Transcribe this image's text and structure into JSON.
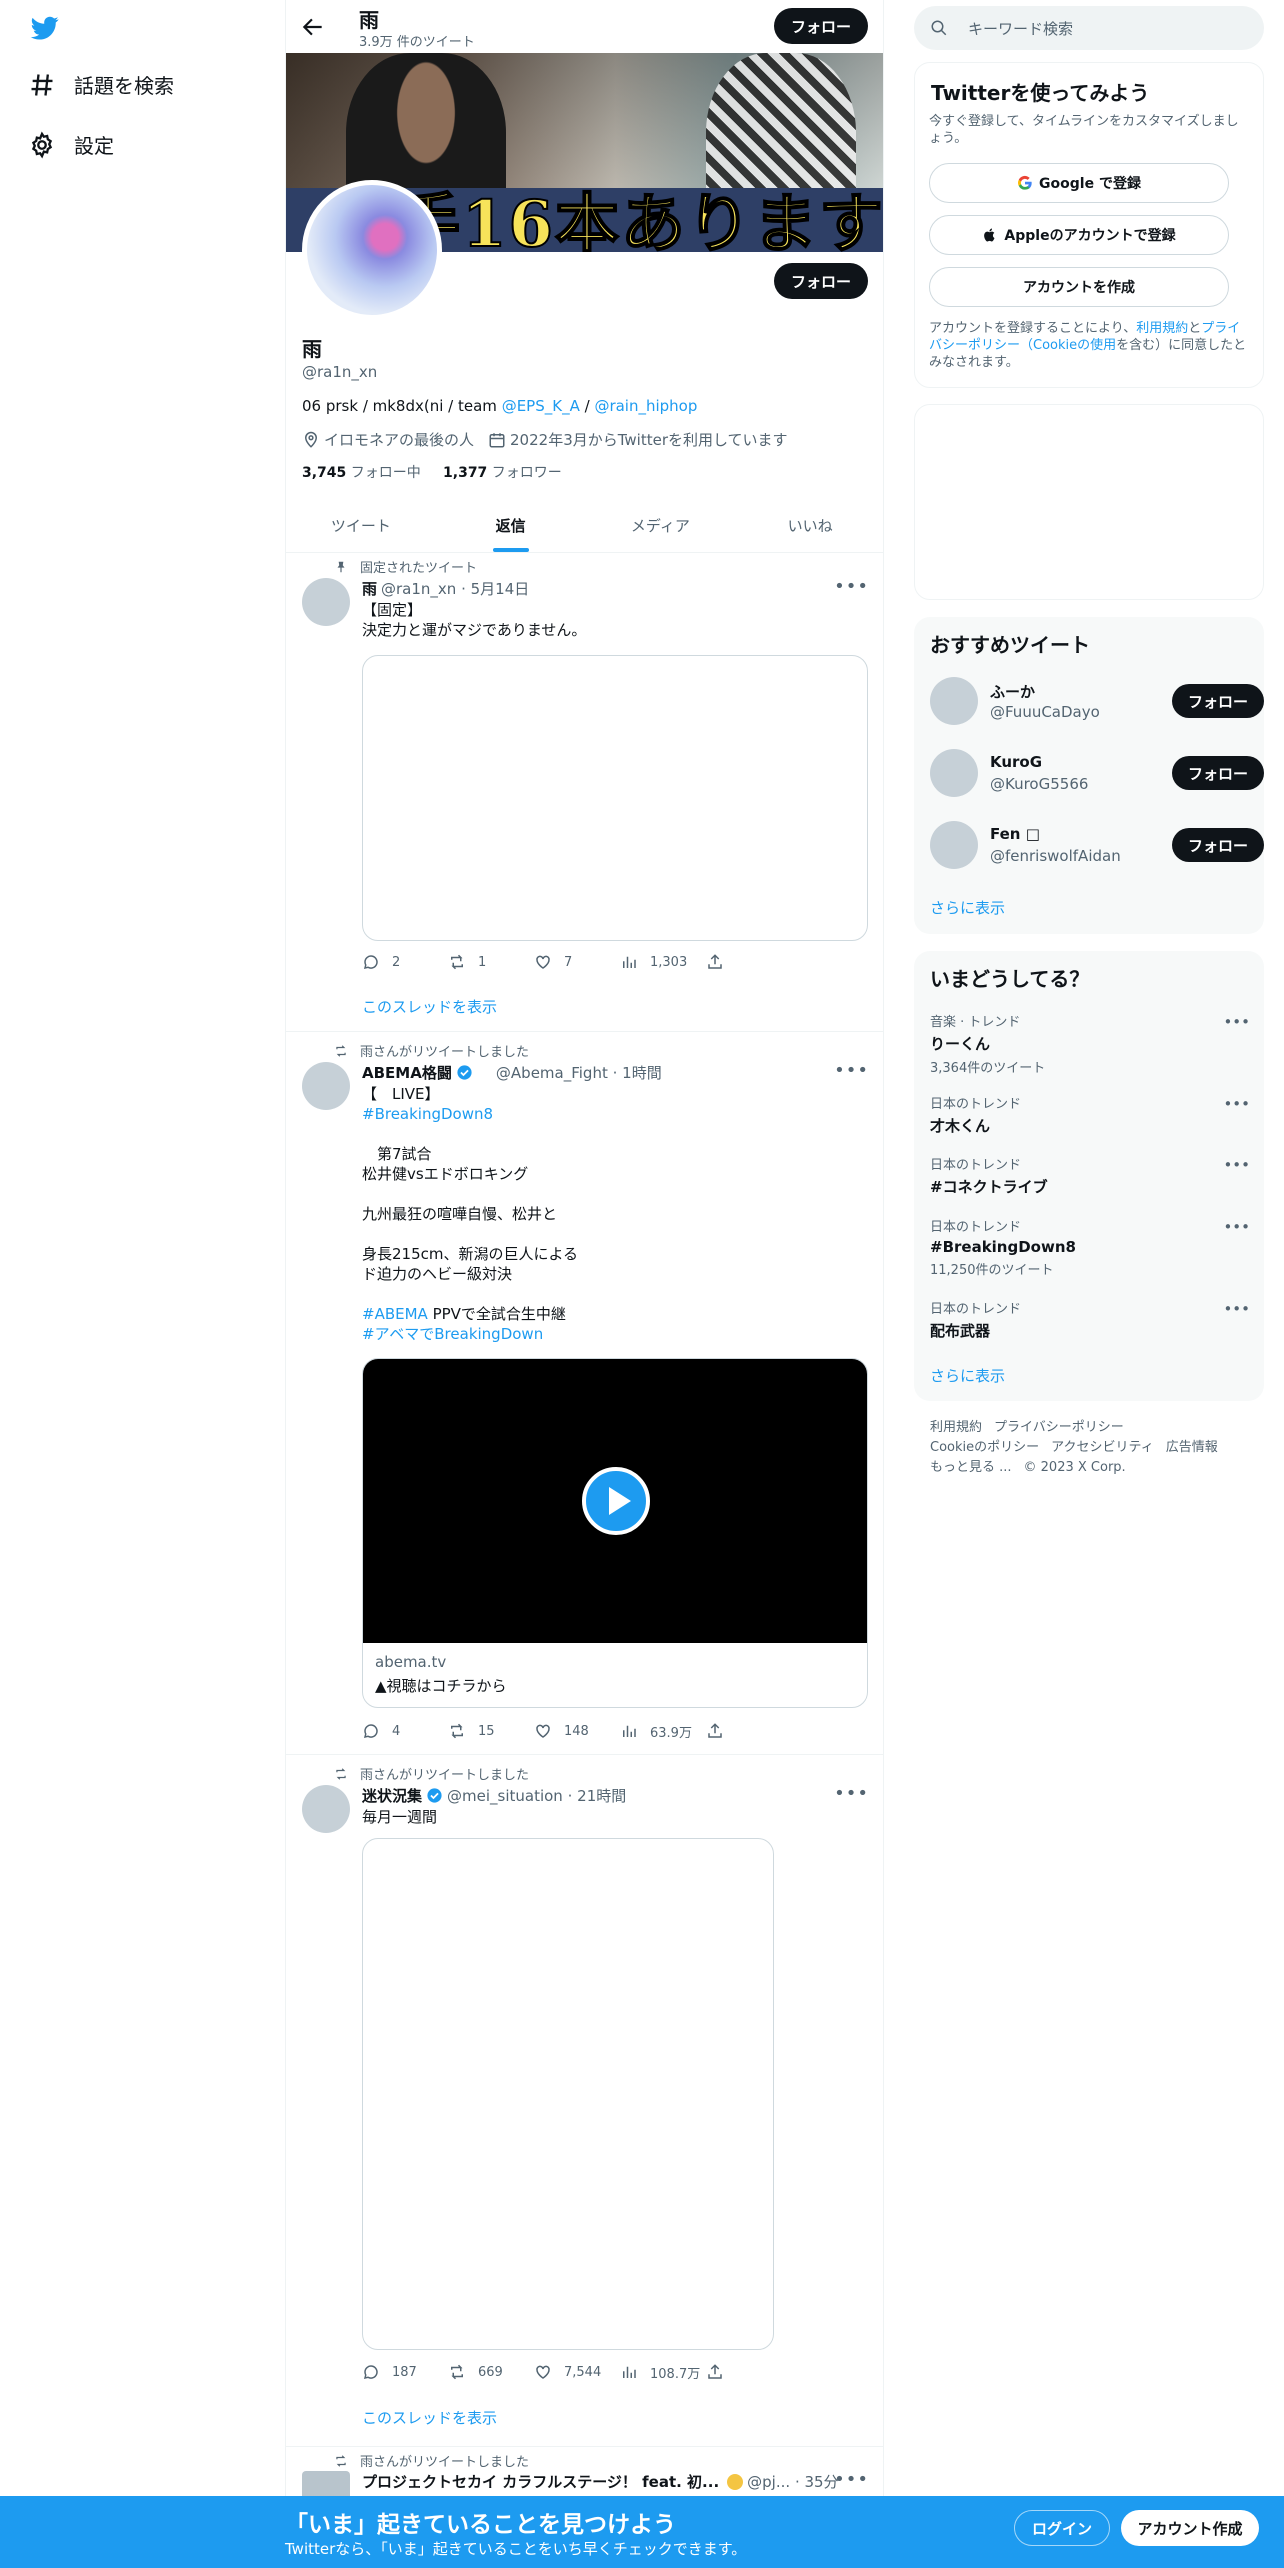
{
  "nav": {
    "logo": "twitter-bird",
    "items": [
      {
        "label": "話題を検索",
        "icon": "hashtag-icon"
      },
      {
        "label": "設定",
        "icon": "gear-icon"
      }
    ]
  },
  "header": {
    "name": "雨",
    "tweet_count": "3.9万 件のツイート",
    "follow_label": "フォロー"
  },
  "banner": {
    "caption": "手16本あります"
  },
  "profile": {
    "name": "雨",
    "handle": "@ra1n_xn",
    "bio_prefix": "06 prsk / mk8dx(ni / team ",
    "bio_link1": "@EPS_K_A",
    "bio_sep": " / ",
    "bio_link2": "@rain_hiphop",
    "location": "イロモネアの最後の人",
    "joined": "2022年3月からTwitterを利用しています",
    "following_count": "3,745",
    "following_label": "フォロー中",
    "followers_count": "1,377",
    "followers_label": "フォロワー",
    "follow_label": "フォロー"
  },
  "tabs": [
    {
      "label": "ツイート",
      "active": false
    },
    {
      "label": "返信",
      "active": true
    },
    {
      "label": "メディア",
      "active": false
    },
    {
      "label": "いいね",
      "active": false
    }
  ],
  "tweets": [
    {
      "context": "固定されたツイート",
      "name": "雨",
      "handle": "@ra1n_xn",
      "time": "· 5月14日",
      "text": "【固定】\n決定力と運がマジでありません。",
      "replies": "2",
      "retweets": "1",
      "likes": "7",
      "views": "1,303",
      "thread": "このスレッドを表示"
    },
    {
      "context": "雨さんがリツイートしました",
      "name": "ABEMA格闘",
      "handle": "@Abema_Fight",
      "time": "· 1時間",
      "text_line1": "【　LIVE】",
      "hashtag1": "#BreakingDown8",
      "text_body": "\n　第7試合\n松井健vsエドボロキング\n\n九州最狂の喧嘩自慢、松井と\n\n身長215cm、新潟の巨人による\nド迫力のヘビー級対決\n",
      "hashtag2": "#ABEMA",
      "text_after_hashtag2": " PPVで全試合生中継",
      "hashtag3": "#アベマでBreakingDown",
      "card_domain": "abema.tv",
      "card_title": "▲視聴はコチラから",
      "replies": "4",
      "retweets": "15",
      "likes": "148",
      "views": "63.9万"
    },
    {
      "context": "雨さんがリツイートしました",
      "name": "迷状況集",
      "handle": "@mei_situation",
      "time": "· 21時間",
      "text": "毎月一週間",
      "replies": "187",
      "retweets": "669",
      "likes": "7,544",
      "views": "108.7万",
      "thread": "このスレッドを表示"
    },
    {
      "context": "雨さんがリツイートしました",
      "name": "プロジェクトセカイ カラフルステージ！ feat. 初...",
      "handle": "@pj...",
      "time": "· 35分"
    }
  ],
  "right": {
    "search_placeholder": "キーワード検索",
    "signup_card": {
      "title": "Twitterを使ってみよう",
      "subtitle": "今すぐ登録して、タイムラインをカスタマイズしましょう。",
      "google": "Google で登録",
      "apple": "Appleのアカウントで登録",
      "create": "アカウントを作成",
      "legal_1": "アカウントを登録することにより、",
      "legal_terms": "利用規約",
      "legal_and": "と",
      "legal_privacy": "プライバシーポリシー（Cookieの使用",
      "legal_2": "を含む）に同意したとみなされます。"
    },
    "recommend": {
      "title": "おすすめツイート",
      "users": [
        {
          "name": "ふーか",
          "handle": "@FuuuCaDayo"
        },
        {
          "name": "KuroG",
          "handle": "@KuroG5566"
        },
        {
          "name": "Fen □",
          "handle": "@fenriswolfAidan"
        }
      ],
      "follow_label": "フォロー",
      "show_more": "さらに表示"
    },
    "trends": {
      "title": "いまどうしてる？",
      "items": [
        {
          "category": "音楽 · トレンド",
          "title": "りーくん",
          "count": "3,364件のツイート"
        },
        {
          "category": "日本のトレンド",
          "title": "才木くん",
          "count": ""
        },
        {
          "category": "日本のトレンド",
          "title": "#コネクトライブ",
          "count": ""
        },
        {
          "category": "日本のトレンド",
          "title": "#BreakingDown8",
          "count": "11,250件のツイート"
        },
        {
          "category": "日本のトレンド",
          "title": "配布武器",
          "count": ""
        }
      ],
      "show_more": "さらに表示"
    },
    "footer": [
      "利用規約",
      "プライバシーポリシー",
      "Cookieのポリシー",
      "アクセシビリティ",
      "広告情報",
      "もっと見る ...",
      "© 2023 X Corp."
    ]
  },
  "bottom": {
    "title": "「いま」起きていることを見つけよう",
    "subtitle": "Twitterなら、「いま」起きていることをいち早くチェックできます。",
    "login": "ログイン",
    "signup": "アカウント作成"
  },
  "colors": {
    "accent": "#1d9bf0",
    "text": "#0f1419",
    "secondary": "#536471"
  }
}
